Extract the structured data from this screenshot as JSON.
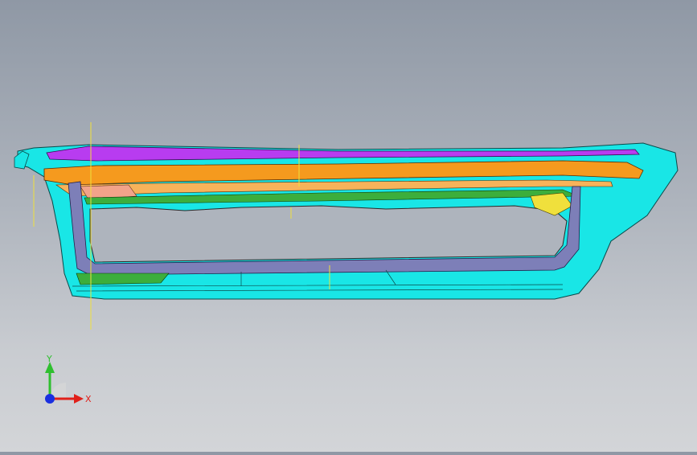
{
  "viewport": {
    "background_top": "#8f98a5",
    "background_bottom": "#d3d5d8"
  },
  "model": {
    "parts": [
      {
        "name": "outer-shell",
        "color": "#19e6e6"
      },
      {
        "name": "top-trim",
        "color": "#b83cf0"
      },
      {
        "name": "upper-rail",
        "color": "#f59a1e"
      },
      {
        "name": "inner-frame",
        "color": "#7d7fb8"
      },
      {
        "name": "lower-rail",
        "color": "#3cae3c"
      },
      {
        "name": "accent",
        "color": "#f0e03c"
      },
      {
        "name": "insert",
        "color": "#f2a38a"
      }
    ]
  },
  "triad": {
    "x_label": "X",
    "y_label": "Y",
    "x_color": "#e0201a",
    "y_color": "#2fbf2f",
    "z_color": "#1a2fe0"
  }
}
